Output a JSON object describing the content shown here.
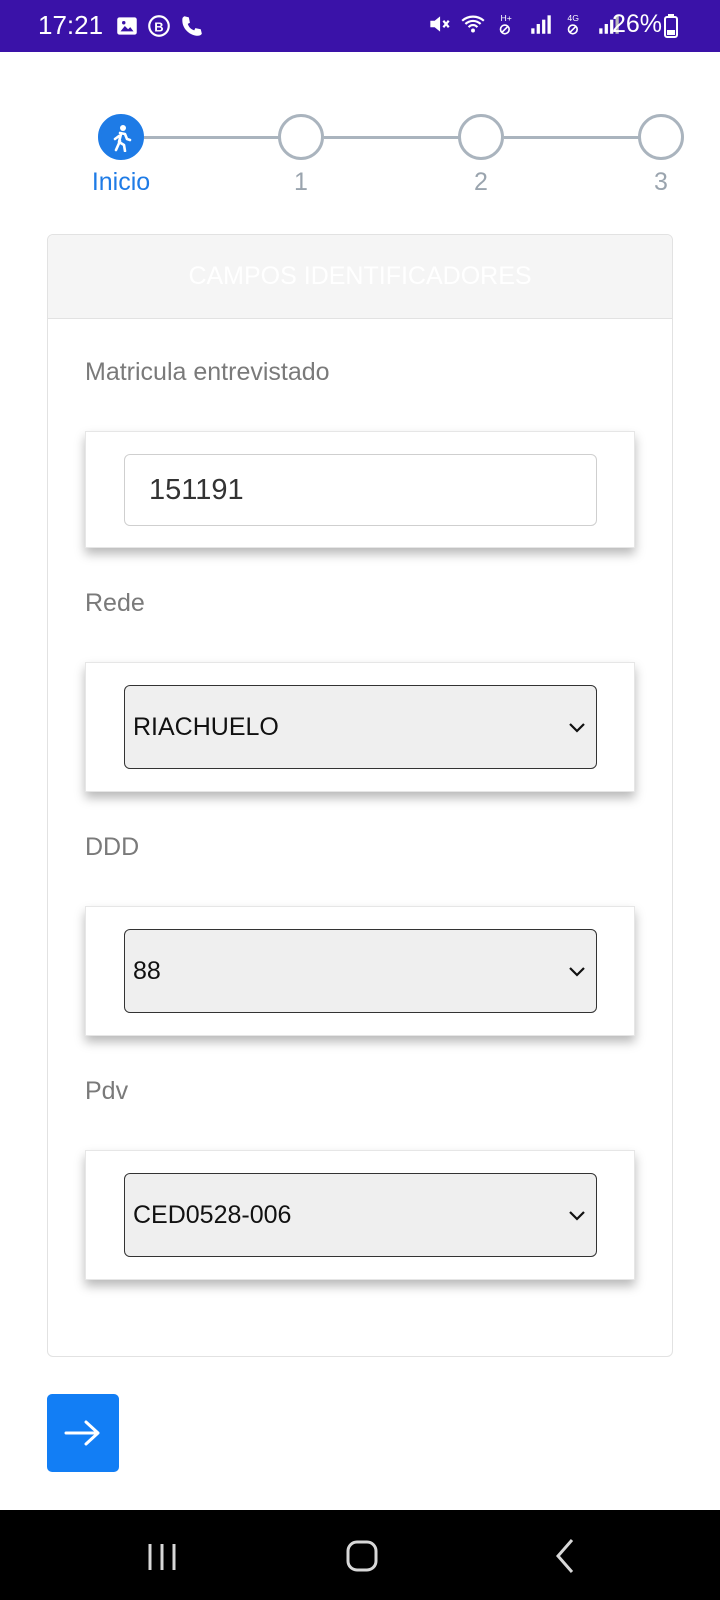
{
  "status_bar": {
    "time": "17:21",
    "battery": "26%",
    "left_icons": [
      "image-icon",
      "b-icon",
      "phone-icon"
    ],
    "right_icons": [
      "mute-icon",
      "wifi-icon",
      "signal-h-icon",
      "signal-icon",
      "signal-4g-icon",
      "signal-icon-2",
      "battery-icon"
    ]
  },
  "stepper": {
    "steps": [
      {
        "label": "Inicio",
        "active": true,
        "icon": "walking-person-icon"
      },
      {
        "label": "1",
        "active": false
      },
      {
        "label": "2",
        "active": false
      },
      {
        "label": "3",
        "active": false
      }
    ]
  },
  "form": {
    "header": "CAMPOS IDENTIFICADORES",
    "fields": [
      {
        "label": "Matricula entrevistado",
        "type": "text",
        "value": "151191"
      },
      {
        "label": "Rede",
        "type": "select",
        "value": "RIACHUELO"
      },
      {
        "label": "DDD",
        "type": "select",
        "value": "88"
      },
      {
        "label": "Pdv",
        "type": "select",
        "value": "CED0528-006"
      }
    ]
  },
  "next_button": {
    "icon": "arrow-right-icon"
  },
  "nav_bar": {
    "icons": [
      "recent-apps-icon",
      "home-icon",
      "back-icon"
    ]
  },
  "colors": {
    "status_bar": "#3a12a8",
    "accent": "#1e7be6",
    "button": "#127ef5",
    "inactive": "#aab4be"
  }
}
